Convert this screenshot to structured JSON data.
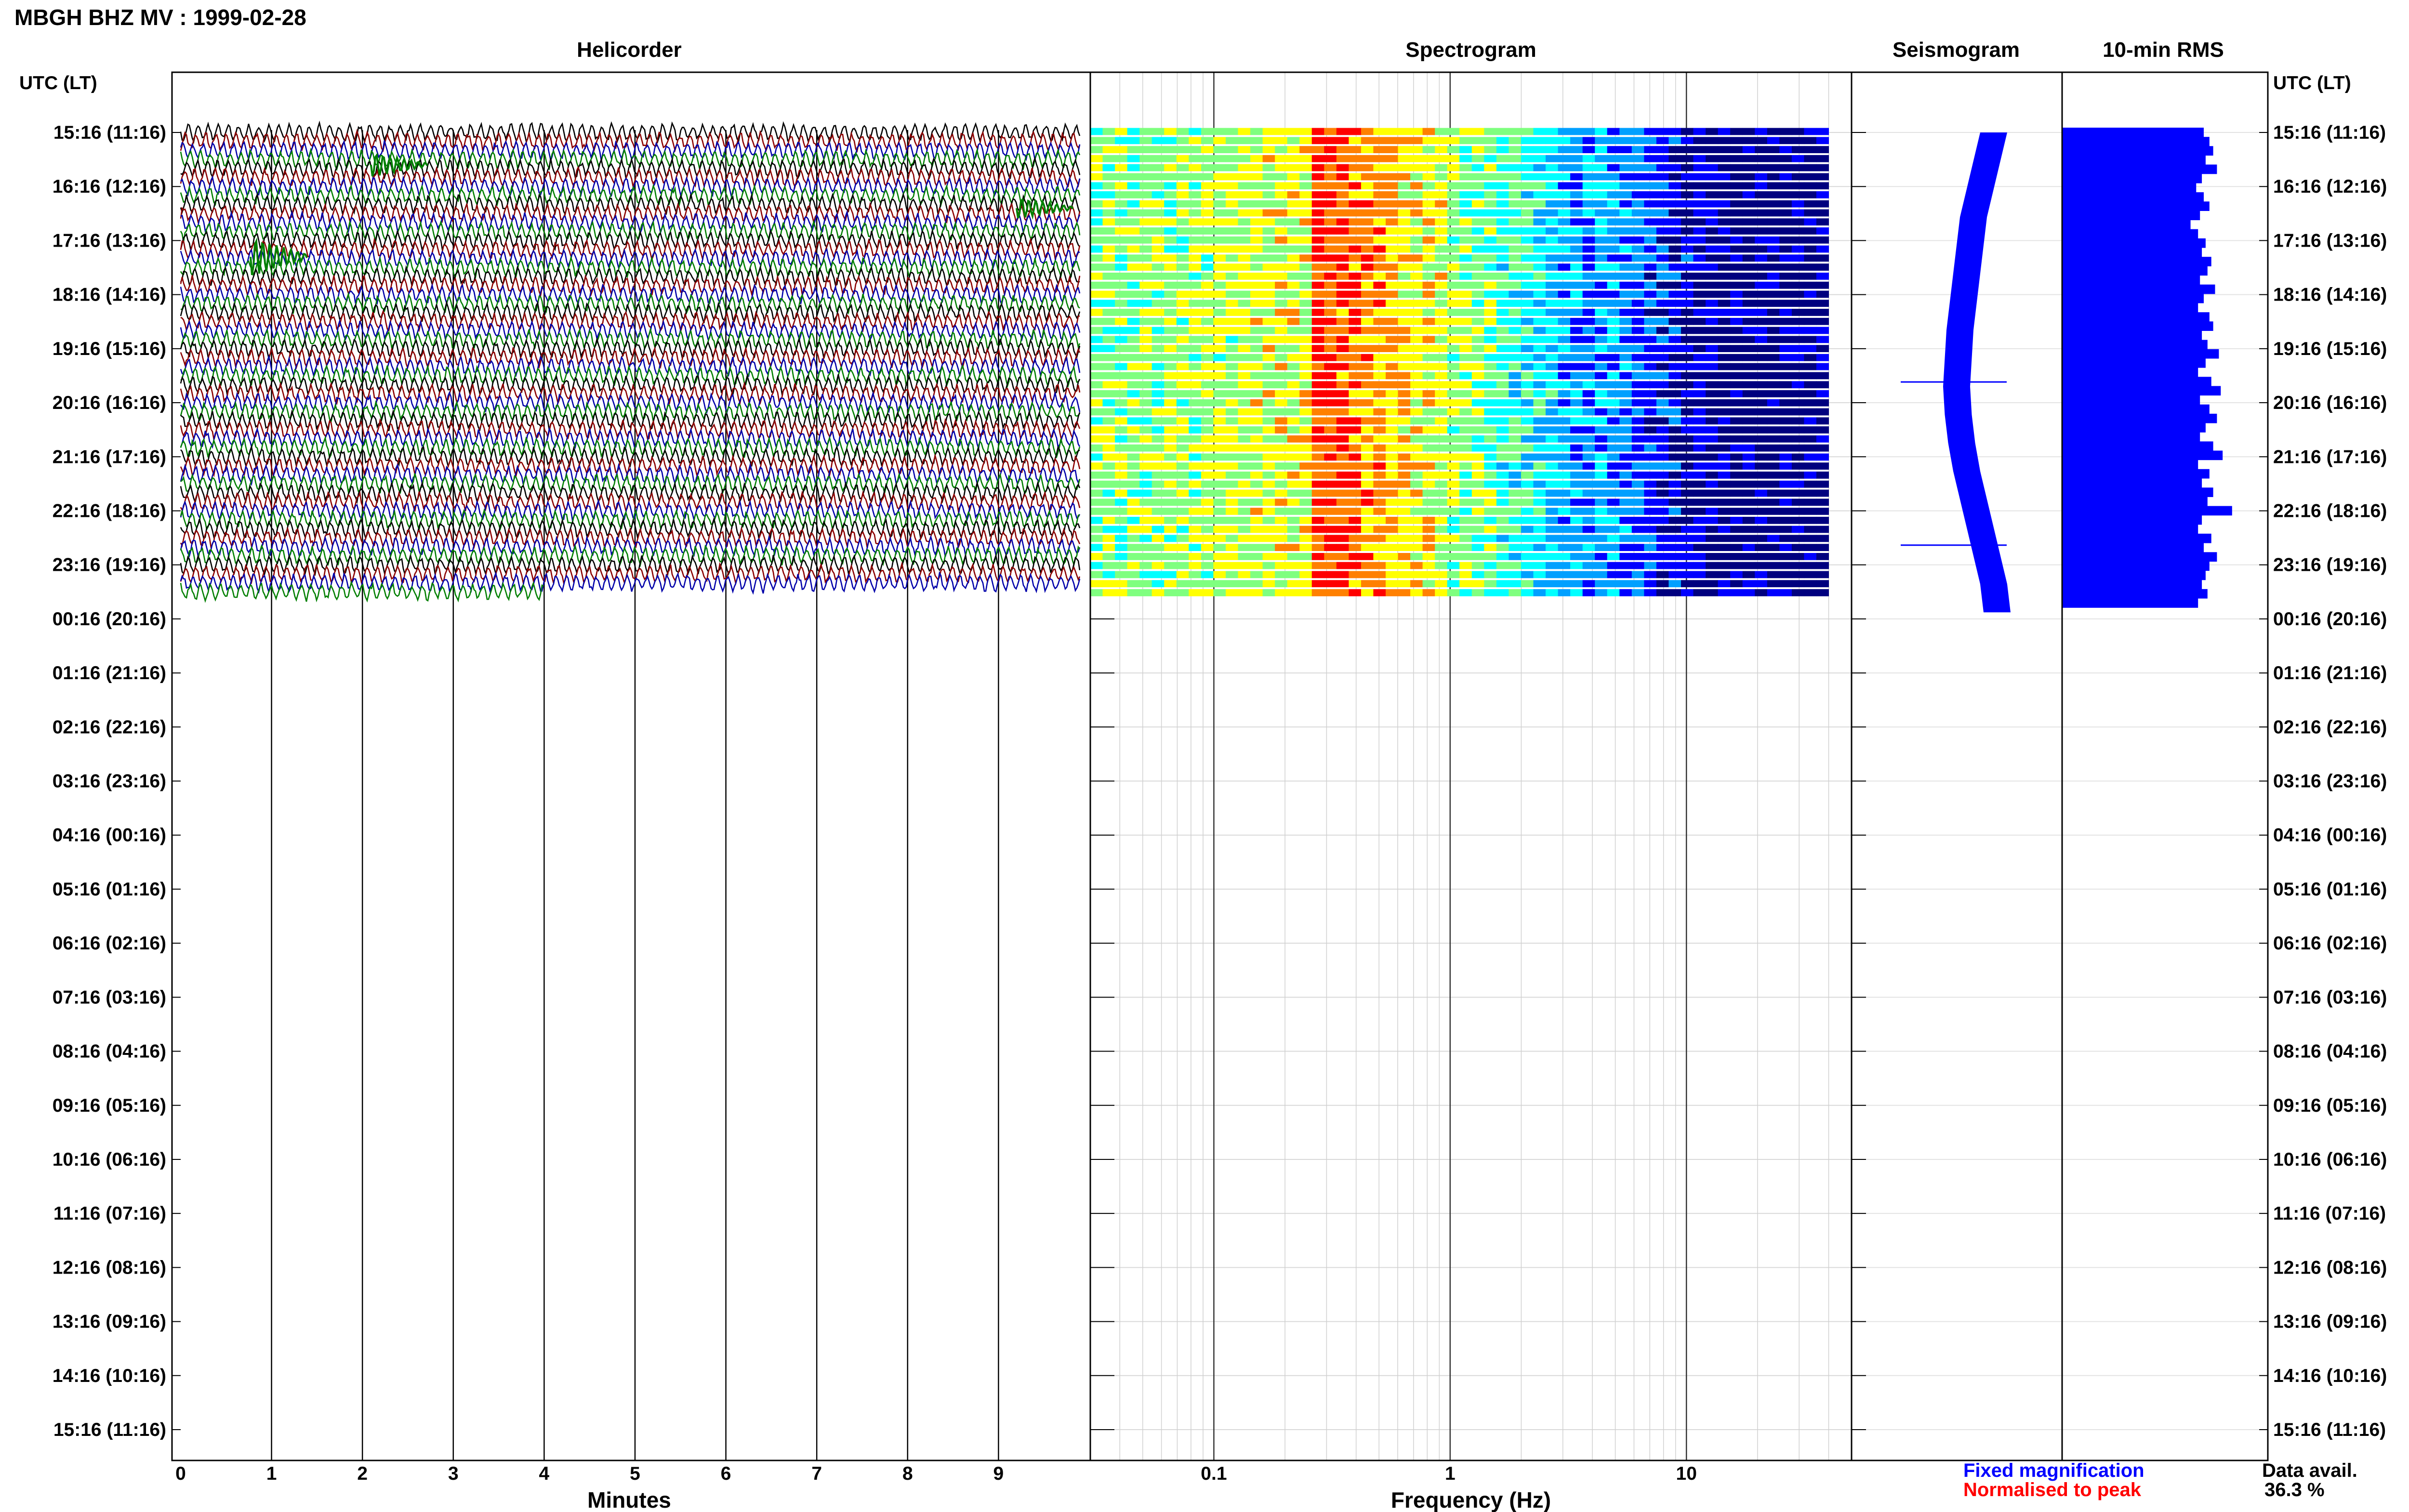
{
  "header": {
    "title": "MBGH BHZ MV : 1999-02-28"
  },
  "panels": {
    "helicorder": "Helicorder",
    "spectrogram": "Spectrogram",
    "seismogram": "Seismogram",
    "rms": "10-min RMS"
  },
  "axes": {
    "utc_header_left": "UTC (LT)",
    "utc_header_right": "UTC (LT)",
    "minutes_label": "Minutes",
    "frequency_label": "Frequency (Hz)"
  },
  "legend": {
    "fixed": "Fixed magnification",
    "normalised": "Normalised to peak"
  },
  "availability": {
    "label": "Data avail.",
    "value": "36.3 %"
  },
  "colors": {
    "helicorder_traces": [
      "#000000",
      "#8b0000",
      "#0000aa",
      "#007f00"
    ],
    "seismogram": "#0000ff",
    "rms": "#0000ff",
    "legend_fixed": "#0000ff",
    "legend_normalised": "#ff0000"
  },
  "chart_data": [
    {
      "type": "line",
      "title": "Helicorder",
      "xlabel": "Minutes",
      "ylabel": "UTC (LT)",
      "x_ticks": [
        "0",
        "1",
        "2",
        "3",
        "4",
        "5",
        "6",
        "7",
        "8",
        "9"
      ],
      "xlim": [
        0,
        10
      ],
      "y_ticks": [
        "15:16 (11:16)",
        "16:16 (12:16)",
        "17:16 (13:16)",
        "18:16 (14:16)",
        "19:16 (15:16)",
        "20:16 (16:16)",
        "21:16 (17:16)",
        "22:16 (18:16)",
        "23:16 (19:16)",
        "00:16 (20:16)",
        "01:16 (21:16)",
        "02:16 (22:16)",
        "03:16 (23:16)",
        "04:16 (00:16)",
        "05:16 (01:16)",
        "06:16 (02:16)",
        "07:16 (03:16)",
        "08:16 (04:16)",
        "09:16 (05:16)",
        "10:16 (06:16)",
        "11:16 (07:16)",
        "12:16 (08:16)",
        "13:16 (09:16)",
        "14:16 (10:16)",
        "15:16 (11:16)"
      ],
      "rows_per_hour": 6,
      "data_hours": 8.7,
      "total_hours": 24,
      "grid": true
    },
    {
      "type": "heatmap",
      "title": "Spectrogram",
      "xlabel": "Frequency (Hz)",
      "x_scale": "log",
      "x_ticks": [
        "0.1",
        "1",
        "10"
      ],
      "xlim": [
        0.03,
        50
      ],
      "data_max_frequency": 40,
      "dominant_band_hz": [
        0.2,
        0.3
      ],
      "colormap": [
        "#00007f",
        "#0000ff",
        "#00a0ff",
        "#00ffff",
        "#7fff7f",
        "#ffff00",
        "#ff8000",
        "#ff0000"
      ],
      "rows": 52,
      "grid": true
    },
    {
      "type": "line",
      "title": "Seismogram",
      "series": [
        {
          "name": "Fixed magnification",
          "values": [
            0.9,
            0.7,
            0.5,
            0.3,
            0.2,
            0.1,
            0.0,
            -0.1,
            -0.15,
            -0.2,
            -0.15,
            -0.05,
            0.1,
            0.3,
            0.5,
            0.7,
            0.9,
            1.0
          ]
        }
      ],
      "spikes_at_fraction": [
        0.52,
        0.86
      ]
    },
    {
      "type": "bar",
      "title": "10-min RMS",
      "orientation": "horizontal",
      "bar_count": 52,
      "values": [
        0.75,
        0.78,
        0.8,
        0.76,
        0.82,
        0.74,
        0.71,
        0.75,
        0.78,
        0.73,
        0.68,
        0.72,
        0.76,
        0.74,
        0.79,
        0.77,
        0.73,
        0.81,
        0.75,
        0.72,
        0.78,
        0.8,
        0.74,
        0.77,
        0.83,
        0.76,
        0.72,
        0.79,
        0.84,
        0.73,
        0.78,
        0.82,
        0.76,
        0.73,
        0.8,
        0.85,
        0.72,
        0.78,
        0.74,
        0.8,
        0.77,
        0.9,
        0.74,
        0.72,
        0.79,
        0.75,
        0.82,
        0.78,
        0.76,
        0.74,
        0.77,
        0.72
      ],
      "peak_value": 1.0,
      "peak_index": 26
    }
  ]
}
